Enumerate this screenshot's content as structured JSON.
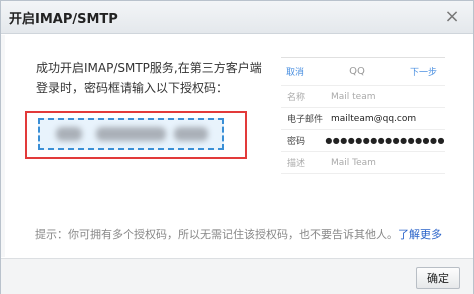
{
  "dialog": {
    "title": "开启IMAP/SMTP",
    "close_glyph": "×"
  },
  "description": {
    "line1": "成功开启IMAP/SMTP服务,在第三方客户端",
    "line2": "登录时，密码框请输入以下授权码："
  },
  "phone_preview": {
    "cancel": "取消",
    "center": "QQ",
    "next": "下一步",
    "rows": [
      {
        "label": "名称",
        "value": "Mail team",
        "faded": true
      },
      {
        "label": "电子邮件",
        "value": "mailteam@qq.com",
        "faded": false
      },
      {
        "label": "密码",
        "value": "●●●●●●●●●●●●●●●●",
        "faded": false
      },
      {
        "label": "描述",
        "value": "Mail Team",
        "faded": true
      }
    ]
  },
  "tip": {
    "text": "提示：你可拥有多个授权码，所以无需记住该授权码，也不要告诉其他人。",
    "link": "了解更多"
  },
  "footer": {
    "ok_label": "确定"
  },
  "colors": {
    "highlight_border": "#e23a3a",
    "code_border": "#3a8fd6",
    "link": "#2a63c9"
  }
}
